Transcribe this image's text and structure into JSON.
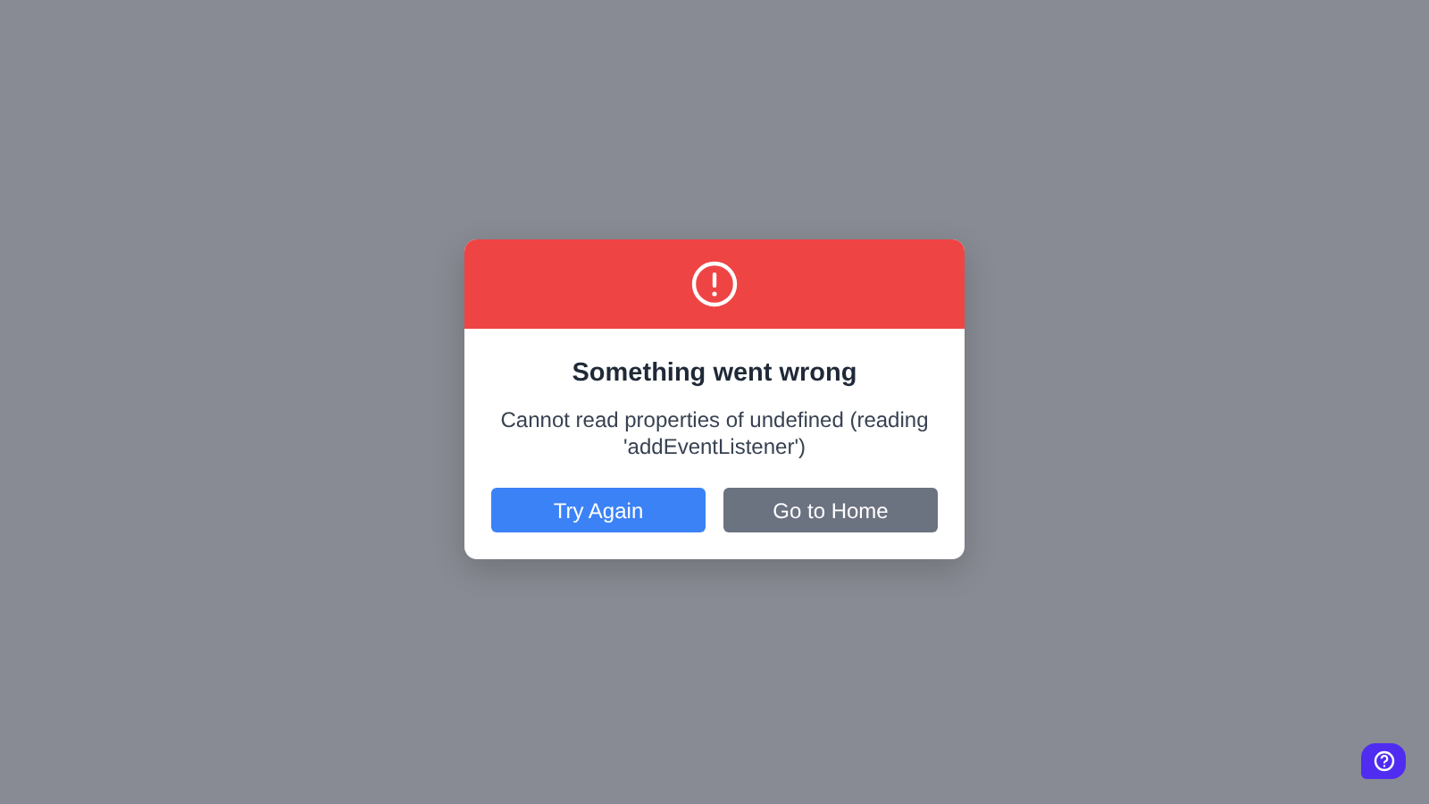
{
  "dialog": {
    "title": "Something went wrong",
    "message": "Cannot read properties of undefined (reading 'addEventListener')",
    "buttons": [
      {
        "label": "Try Again",
        "kind": "primary"
      },
      {
        "label": "Go to Home",
        "kind": "secondary"
      }
    ]
  }
}
